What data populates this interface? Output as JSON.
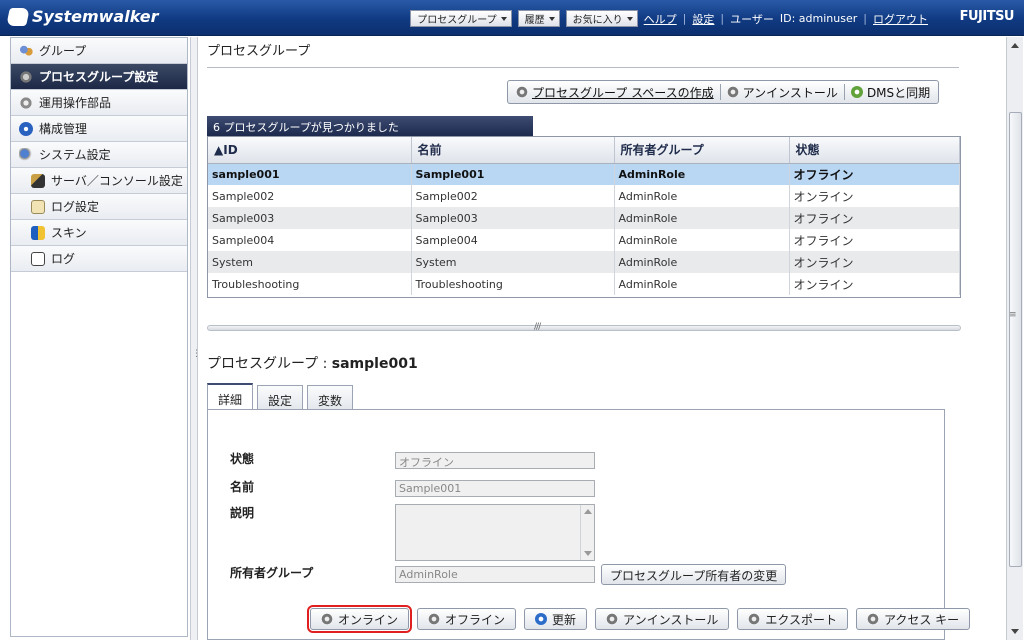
{
  "header": {
    "logo": "Systemwalker",
    "menus": [
      "プロセスグループ",
      "履歴",
      "お気に入り"
    ],
    "help": "ヘルプ",
    "settings": "設定",
    "user_label": "ユーザー",
    "user_id": "ID: adminuser",
    "logout": "ログアウト",
    "brand": "FUJITSU"
  },
  "sidebar": {
    "items": [
      {
        "label": "グループ",
        "icon": "group-icon"
      },
      {
        "label": "プロセスグループ設定",
        "icon": "gear-icon",
        "active": true
      },
      {
        "label": "運用操作部品",
        "icon": "parts-icon"
      },
      {
        "label": "構成管理",
        "icon": "config-icon"
      },
      {
        "label": "システム設定",
        "icon": "system-icon"
      },
      {
        "label": "サーバ／コンソール設定",
        "icon": "server-icon"
      },
      {
        "label": "ログ設定",
        "icon": "log-settings-icon"
      },
      {
        "label": "スキン",
        "icon": "skin-icon"
      },
      {
        "label": "ログ",
        "icon": "log-icon"
      }
    ]
  },
  "main": {
    "title": "プロセスグループ",
    "toolbar": {
      "create": "プロセスグループ スペースの作成",
      "uninstall": "アンインストール",
      "sync": "DMSと同期"
    },
    "found_text": "6 プロセスグループが見つかりました",
    "columns": [
      "ID",
      "名前",
      "所有者グループ",
      "状態"
    ],
    "rows": [
      {
        "id": "sample001",
        "name": "Sample001",
        "owner": "AdminRole",
        "state": "オフライン"
      },
      {
        "id": "Sample002",
        "name": "Sample002",
        "owner": "AdminRole",
        "state": "オンライン"
      },
      {
        "id": "Sample003",
        "name": "Sample003",
        "owner": "AdminRole",
        "state": "オフライン"
      },
      {
        "id": "Sample004",
        "name": "Sample004",
        "owner": "AdminRole",
        "state": "オフライン"
      },
      {
        "id": "System",
        "name": "System",
        "owner": "AdminRole",
        "state": "オンライン"
      },
      {
        "id": "Troubleshooting",
        "name": "Troubleshooting",
        "owner": "AdminRole",
        "state": "オンライン"
      }
    ],
    "detail": {
      "title_prefix": "プロセスグループ : ",
      "title_id": "sample001",
      "tabs": [
        "詳細",
        "設定",
        "変数"
      ],
      "labels": {
        "state": "状態",
        "name": "名前",
        "description": "説明",
        "owner": "所有者グループ"
      },
      "values": {
        "state": "オフライン",
        "name": "Sample001",
        "owner": "AdminRole"
      },
      "change_owner": "プロセスグループ所有者の変更",
      "actions": [
        "オンライン",
        "オフライン",
        "更新",
        "アンインストール",
        "エクスポート",
        "アクセス キー"
      ]
    }
  },
  "colors": {
    "header": "#103a82",
    "selected_row": "#b9d6f3",
    "highlight": "#e02020"
  }
}
